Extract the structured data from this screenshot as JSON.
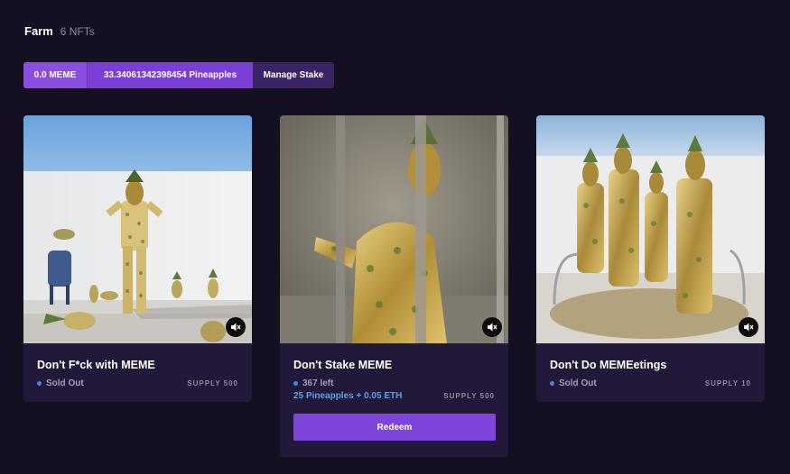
{
  "header": {
    "title": "Farm",
    "count": "6 NFTs"
  },
  "stake": {
    "meme_balance": "0.0 MEME",
    "pineapple_balance": "33.34061342398454 Pineapples",
    "manage_label": "Manage Stake"
  },
  "cards": [
    {
      "name": "Don't F*ck with MEME",
      "status": "Sold Out",
      "supply": "SUPPLY 500",
      "mute_icon": "speaker-muted-icon"
    },
    {
      "name": "Don't Stake MEME",
      "status": "367 left",
      "price": "25 Pineapples + 0.05 ETH",
      "supply": "SUPPLY 500",
      "redeem_label": "Redeem",
      "mute_icon": "speaker-muted-icon"
    },
    {
      "name": "Don't Do MEMEetings",
      "status": "Sold Out",
      "supply": "SUPPLY 10",
      "mute_icon": "speaker-muted-icon"
    }
  ],
  "colors": {
    "accent": "#7e44dc",
    "status_dot": "#3d8bdc",
    "price": "#4da3f0",
    "background": "#141021",
    "card": "#22193a"
  }
}
